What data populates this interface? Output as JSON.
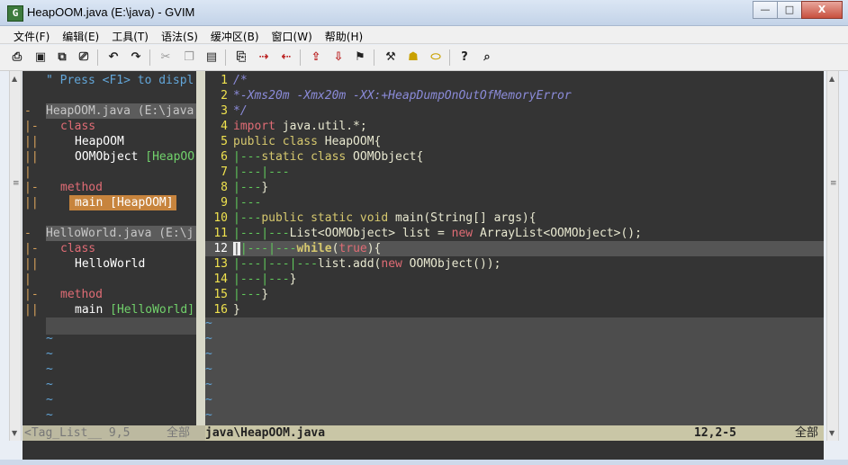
{
  "window": {
    "title": "HeapOOM.java (E:\\java) - GVIM",
    "icon": "G",
    "min": "—",
    "max": "□",
    "close": "X"
  },
  "menu": [
    "文件(F)",
    "编辑(E)",
    "工具(T)",
    "语法(S)",
    "缓冲区(B)",
    "窗口(W)",
    "帮助(H)"
  ],
  "taglist": {
    "help": "\" Press <F1> to displ",
    "file1": "HeapOOM.java (E:\\java",
    "file1_class_label": "class",
    "file1_class_name": "HeapOOM",
    "file1_class_item2": "OOMObject",
    "file1_class_item2_sig": "[HeapOO",
    "file1_method_label": "method",
    "file1_method_name": "main",
    "file1_method_sig": "[HeapOOM]",
    "file2": "HelloWorld.java (E:\\j",
    "file2_class_label": "class",
    "file2_class_name": "HelloWorld",
    "file2_method_label": "method",
    "file2_method_name": "main",
    "file2_method_sig": "[HelloWorld]"
  },
  "code": {
    "l1": "/*",
    "l2": "*-Xms20m -Xmx20m -XX:+HeapDumpOnOutOfMemoryError",
    "l3": "*/",
    "l4_kw": "import",
    "l4_rest": " java.util.*;",
    "l5_kw": "public class",
    "l5_rest": " HeapOOM{",
    "l6_guide": "|---",
    "l6_kw": "static class",
    "l6_rest": " OOMObject{",
    "l7": "|---|---",
    "l8_guide": "|---",
    "l8_rest": "}",
    "l9": "|---",
    "l10_guide": "|---",
    "l10_kw": "public static void",
    "l10_rest": " main(String[] args){",
    "l11_guide": "|---|---",
    "l11_a": "List<OOMObject> list = ",
    "l11_kw": "new",
    "l11_b": " ArrayList<OOMObject>();",
    "l12_guide": "|---|---",
    "l12_kw": "while",
    "l12_p1": "(",
    "l12_true": "true",
    "l12_p2": "){",
    "l13_guide": "|---|---|---",
    "l13_a": "list.add(",
    "l13_kw": "new",
    "l13_b": " OOMObject());",
    "l14_guide": "|---|---",
    "l14_rest": "}",
    "l15_guide": "|---",
    "l15_rest": "}",
    "l16": "}"
  },
  "line_numbers": [
    "1",
    "2",
    "3",
    "4",
    "5",
    "6",
    "7",
    "8",
    "9",
    "10",
    "11",
    "12",
    "13",
    "14",
    "15",
    "16"
  ],
  "status": {
    "left_name": "<Tag_List__ 9,5",
    "left_all": "全部",
    "file": "java\\HeapOOM.java",
    "pos": "12,2-5",
    "all": "全部"
  },
  "colors": {
    "editor_bg": "#343434",
    "line_number": "#f0e24e",
    "keyword": "#e06c75",
    "comment": "#8b8bd9"
  }
}
